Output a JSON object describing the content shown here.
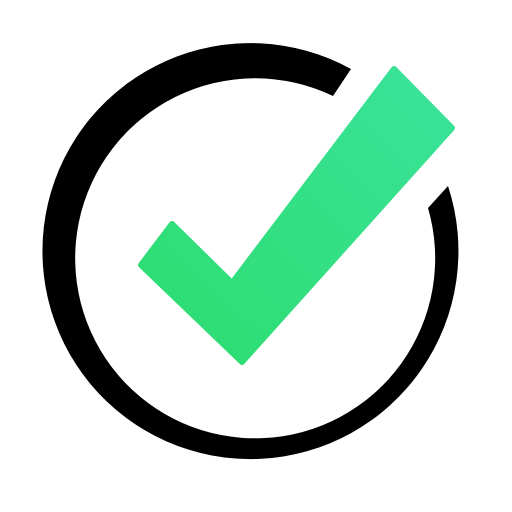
{
  "icon": {
    "name": "checkmark-in-circle-icon",
    "colors": {
      "background": "#ffffff",
      "ring": "#000000",
      "check_start": "#2ddc6f",
      "check_end": "#3ae39a"
    }
  }
}
